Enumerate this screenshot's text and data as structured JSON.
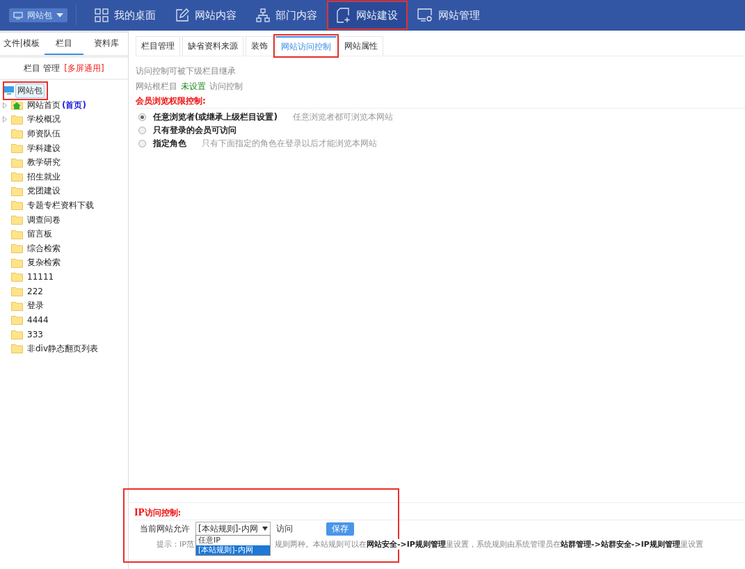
{
  "top_nav": {
    "site_switcher": "网站包",
    "items": [
      {
        "label": "我的桌面",
        "selected": false,
        "highlighted": false
      },
      {
        "label": "网站内容",
        "selected": false,
        "highlighted": false
      },
      {
        "label": "部门内容",
        "selected": false,
        "highlighted": false
      },
      {
        "label": "网站建设",
        "selected": true,
        "highlighted": true
      },
      {
        "label": "网站管理",
        "selected": false,
        "highlighted": false
      }
    ]
  },
  "sidebar": {
    "tabs": [
      {
        "label": "文件|模板",
        "selected": false
      },
      {
        "label": "栏目",
        "selected": true
      },
      {
        "label": "资料库",
        "selected": false
      }
    ],
    "header": {
      "title": "栏目 管理",
      "tag": "[多屏通用]"
    },
    "tree": {
      "label": "网站包",
      "highlighted": true,
      "children": [
        {
          "label": "网站首页",
          "suffix": "(首页)",
          "kind": "home",
          "has_children": true
        },
        {
          "label": "学校概况",
          "kind": "folder",
          "has_children": true
        },
        {
          "label": "师资队伍",
          "kind": "folder",
          "has_children": false
        },
        {
          "label": "学科建设",
          "kind": "folder",
          "has_children": false
        },
        {
          "label": "教学研究",
          "kind": "folder",
          "has_children": false
        },
        {
          "label": "招生就业",
          "kind": "folder",
          "has_children": false
        },
        {
          "label": "党团建设",
          "kind": "folder",
          "has_children": false
        },
        {
          "label": "专题专栏资料下载",
          "kind": "folder",
          "has_children": false
        },
        {
          "label": "调查问卷",
          "kind": "folder",
          "has_children": false
        },
        {
          "label": "留言板",
          "kind": "folder",
          "has_children": false
        },
        {
          "label": "综合检索",
          "kind": "folder",
          "has_children": false
        },
        {
          "label": "复杂检索",
          "kind": "folder",
          "has_children": false
        },
        {
          "label": "11111",
          "kind": "folder",
          "has_children": false
        },
        {
          "label": "222",
          "kind": "folder",
          "has_children": false
        },
        {
          "label": "登录",
          "kind": "folder",
          "has_children": false
        },
        {
          "label": "4444",
          "kind": "folder",
          "has_children": false
        },
        {
          "label": "333",
          "kind": "folder",
          "has_children": false
        },
        {
          "label": "非div静态翻页列表",
          "kind": "folder",
          "has_children": false
        }
      ]
    }
  },
  "content_tabs": [
    {
      "label": "栏目管理",
      "selected": false,
      "highlighted": false
    },
    {
      "label": "缺省资料来源",
      "selected": false,
      "highlighted": false
    },
    {
      "label": "装饰",
      "selected": false,
      "highlighted": false
    },
    {
      "label": "网站访问控制",
      "selected": true,
      "highlighted": true
    },
    {
      "label": "网站属性",
      "selected": false,
      "highlighted": false
    }
  ],
  "inherit_note": "访问控制可被下级栏目继承",
  "root_status": {
    "prefix": "网站根栏目",
    "status": "未设置",
    "suffix": "访问控制"
  },
  "member_section": {
    "title": "会员浏览权限控制:",
    "options": [
      {
        "label": "任意浏览者(或继承上级栏目设置)",
        "hint": "任意浏览者都可浏览本网站",
        "selected": true
      },
      {
        "label": "只有登录的会员可访问",
        "selected": false
      },
      {
        "label": "指定角色",
        "hint": "只有下面指定的角色在登录以后才能浏览本网站",
        "selected": false
      }
    ]
  },
  "ip_section": {
    "title": "IP访问控制:",
    "highlighted": true,
    "allow_label": "当前网站允许",
    "select_value": "[本站规则]-内网",
    "after_label": "访问",
    "save_button": "保存",
    "dropdown_options": [
      {
        "label": "任意IP",
        "selected": false
      },
      {
        "label": "[本站规则]-内网",
        "selected": true
      }
    ],
    "hint_start": "提示：IP范",
    "hint_end": "规则两种。本站规则可以在**网站安全->IP规则管理**里设置，系统规则由系统管理员在**站群管理->站群安全->IP规则管理**里设置"
  }
}
